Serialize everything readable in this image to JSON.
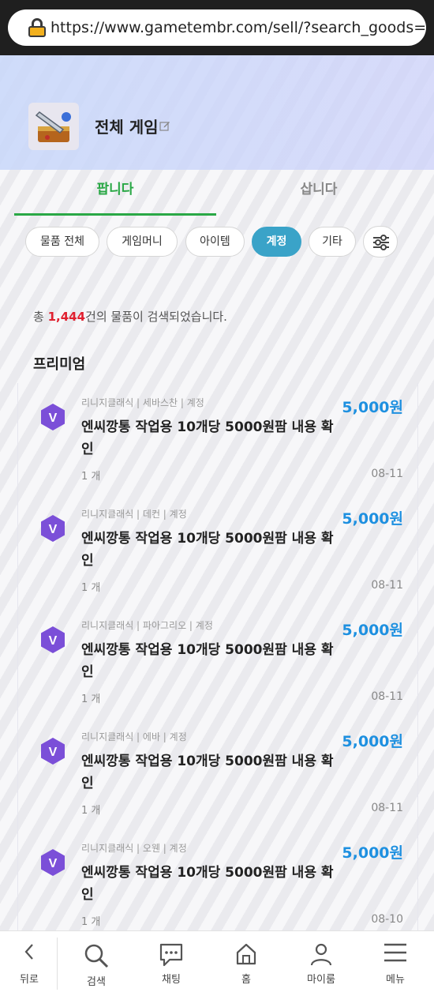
{
  "browser": {
    "url": "https://www.gametembr.com/sell/?search_goods=c"
  },
  "header": {
    "title": "전체 게임"
  },
  "tabs": [
    {
      "label": "팝니다",
      "active": true
    },
    {
      "label": "삽니다",
      "active": false
    }
  ],
  "filters": [
    {
      "label": "물품 전체"
    },
    {
      "label": "게임머니"
    },
    {
      "label": "아이템"
    },
    {
      "label": "계정",
      "active": true
    },
    {
      "label": "기타"
    }
  ],
  "result": {
    "prefix": "총 ",
    "count": "1,444",
    "suffix": "건의 물품이 검색되었습니다."
  },
  "section_title": "프리미엄",
  "listings": [
    {
      "meta": "리니지클래식 | 세바스찬 | 계정",
      "price": "5,000원",
      "title": "엔씨깡통 작업용 10개당 5000원팜 내용 확인",
      "qty": "1 개",
      "date": "08-11"
    },
    {
      "meta": "리니지클래식 | 데컨 | 계정",
      "price": "5,000원",
      "title": "엔씨깡통 작업용 10개당 5000원팜 내용 확인",
      "qty": "1 개",
      "date": "08-11"
    },
    {
      "meta": "리니지클래식 | 파아그리오 | 계정",
      "price": "5,000원",
      "title": "엔씨깡통 작업용 10개당 5000원팜 내용 확인",
      "qty": "1 개",
      "date": "08-11"
    },
    {
      "meta": "리니지클래식 | 에바 | 계정",
      "price": "5,000원",
      "title": "엔씨깡통 작업용 10개당 5000원팜 내용 확인",
      "qty": "1 개",
      "date": "08-11"
    },
    {
      "meta": "리니지클래식 | 오웬 | 계정",
      "price": "5,000원",
      "title": "엔씨깡통 작업용 10개당 5000원팜 내용 확인",
      "qty": "1 개",
      "date": "08-10"
    }
  ],
  "badge_letter": "V",
  "bottom_nav": [
    {
      "label": "뒤로",
      "icon": "chevron-left-icon"
    },
    {
      "label": "검색",
      "icon": "search-icon"
    },
    {
      "label": "채팅",
      "icon": "chat-icon"
    },
    {
      "label": "홈",
      "icon": "home-icon"
    },
    {
      "label": "마이룸",
      "icon": "user-icon"
    },
    {
      "label": "메뉴",
      "icon": "hamburger-menu-icon"
    }
  ],
  "colors": {
    "accent_green": "#2aa846",
    "active_chip": "#3aa3c8",
    "price_blue": "#1e90e0",
    "count_red": "#e0202f",
    "badge_purple": "#7b4fd8"
  }
}
